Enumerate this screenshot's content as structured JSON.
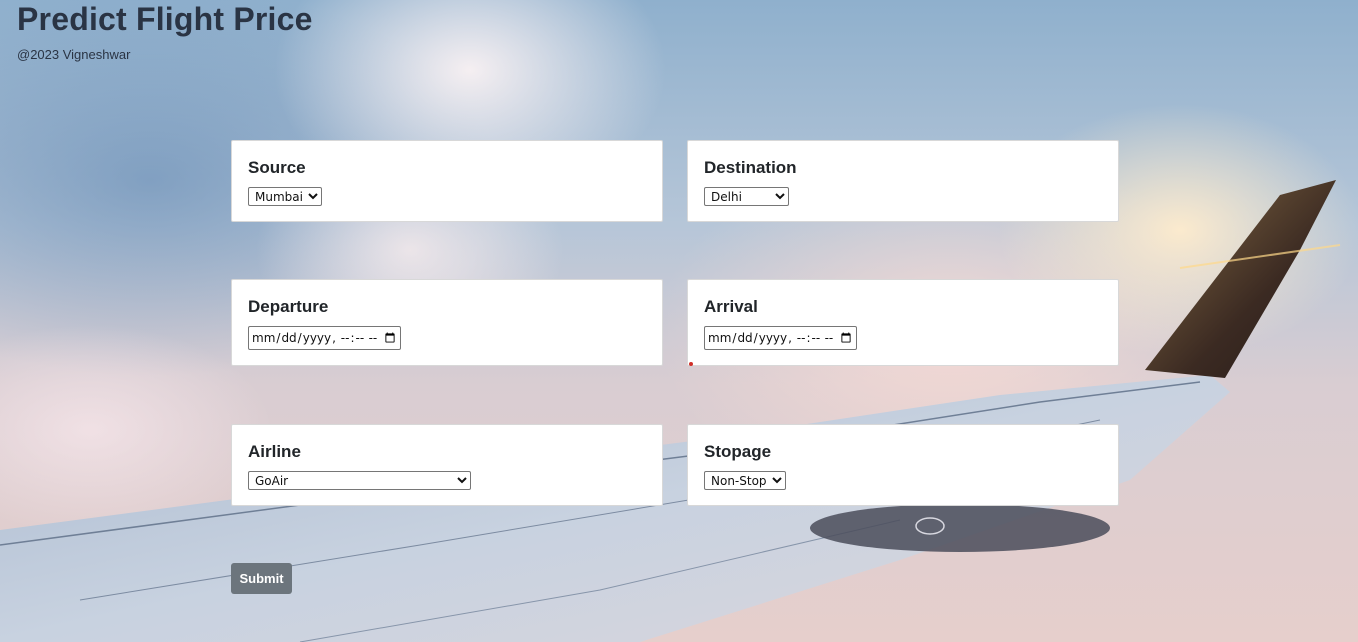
{
  "page": {
    "title": "Predict Flight Price",
    "credit": "@2023 Vigneshwar"
  },
  "form": {
    "source": {
      "label": "Source",
      "selected": "Mumbai"
    },
    "destination": {
      "label": "Destination",
      "selected": "Delhi"
    },
    "departure": {
      "label": "Departure",
      "placeholder": "dd-mm-yyyy --:--"
    },
    "arrival": {
      "label": "Arrival",
      "placeholder": "dd-mm-yyyy --:--"
    },
    "airline": {
      "label": "Airline",
      "selected": "GoAir"
    },
    "stopage": {
      "label": "Stopage",
      "selected": "Non-Stop"
    },
    "submit_label": "Submit"
  },
  "colors": {
    "card_background": "#ffffff",
    "submit_button": "#6c757d",
    "title_text": "#2a3444"
  }
}
